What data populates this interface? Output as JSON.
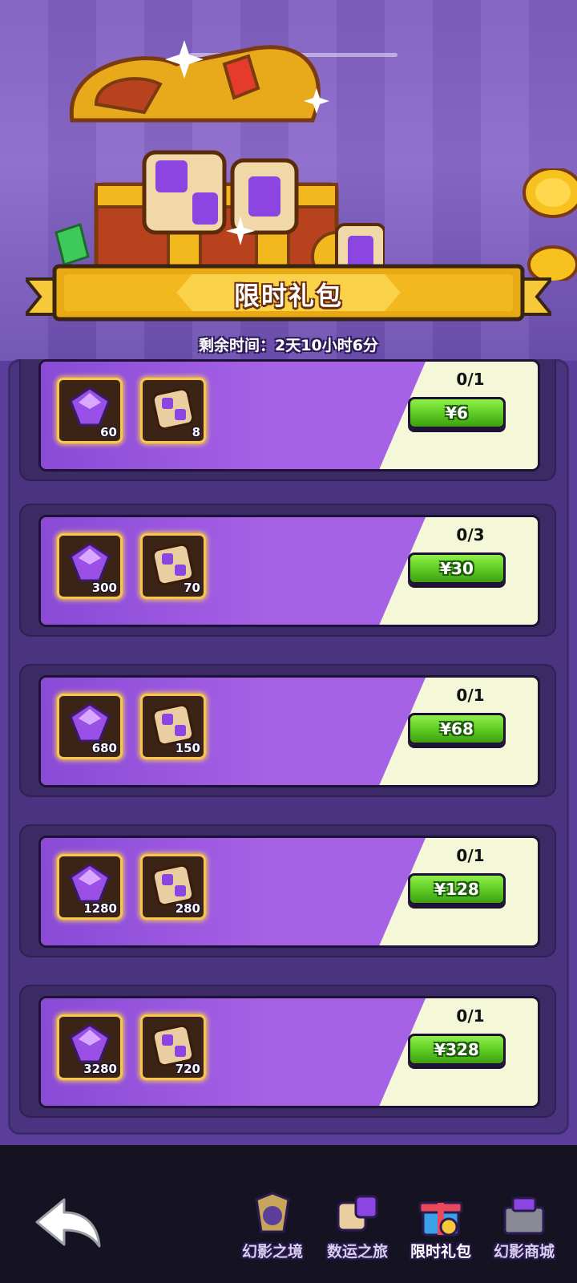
{
  "header": {
    "title": "限时礼包",
    "timer_text": "剩余时间：2天10小时6分"
  },
  "packs": [
    {
      "limit": "0/1",
      "price": "¥6",
      "gems": "60",
      "dice": "8"
    },
    {
      "limit": "0/3",
      "price": "¥30",
      "gems": "300",
      "dice": "70"
    },
    {
      "limit": "0/1",
      "price": "¥68",
      "gems": "680",
      "dice": "150"
    },
    {
      "limit": "0/1",
      "price": "¥128",
      "gems": "1280",
      "dice": "280"
    },
    {
      "limit": "0/1",
      "price": "¥328",
      "gems": "3280",
      "dice": "720"
    }
  ],
  "nav": {
    "items": [
      {
        "label": "幻影之境",
        "icon": "phantom-realm-icon"
      },
      {
        "label": "数运之旅",
        "icon": "dice-journey-icon"
      },
      {
        "label": "限时礼包",
        "icon": "gift-box-icon"
      },
      {
        "label": "幻影商城",
        "icon": "phantom-shop-icon"
      }
    ],
    "active_index": 2
  },
  "colors": {
    "accent_purple": "#a662e6",
    "price_green": "#58c420",
    "banner_gold": "#f2b81e",
    "card_light": "#f4f8d8"
  }
}
